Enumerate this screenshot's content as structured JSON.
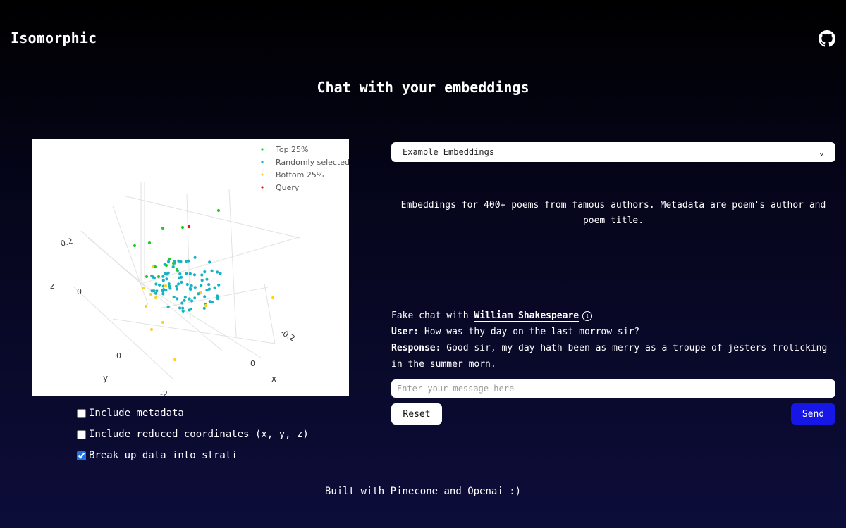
{
  "header": {
    "brand": "Isomorphic",
    "github_icon": "github-icon"
  },
  "page_title": "Chat with your embeddings",
  "plot": {
    "legend": [
      {
        "label": "Top 25%",
        "color": "#22cc22"
      },
      {
        "label": "Randomly selected",
        "color": "#17b3c4"
      },
      {
        "label": "Bottom 25%",
        "color": "#ffd21a"
      },
      {
        "label": "Query",
        "color": "#ee1111"
      }
    ],
    "axis_titles": {
      "x": "x",
      "y": "y",
      "z": "z"
    },
    "tick_labels": {
      "z_top": "0.2",
      "z_mid": "0",
      "x_near": "-0.2",
      "x_mid": "0",
      "y_mid": "0",
      "y_cut": "-2"
    }
  },
  "options": {
    "include_metadata": {
      "label": "Include metadata",
      "checked": false
    },
    "include_coords": {
      "label": "Include reduced coordinates (x, y, z)",
      "checked": false
    },
    "strati": {
      "label": "Break up data into strati",
      "checked": true
    }
  },
  "dataset_select": {
    "value": "Example Embeddings"
  },
  "description": "Embeddings for 400+ poems from famous authors. Metadata are poem's author and poem title.",
  "chat": {
    "prefix": "Fake chat with",
    "persona": "William Shakespeare",
    "user_label": "User:",
    "user_text": "How was thy day on the last morrow sir?",
    "response_label": "Response:",
    "response_text": "Good sir, my day hath been as merry as a troupe of jesters frolicking in the summer morn."
  },
  "message_input": {
    "placeholder": "Enter your message here",
    "value": ""
  },
  "buttons": {
    "reset": "Reset",
    "send": "Send"
  },
  "footer": "Built with Pinecone and Openai :)"
}
